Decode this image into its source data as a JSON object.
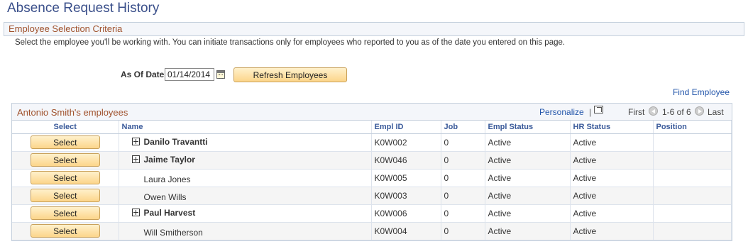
{
  "page": {
    "title": "Absence Request History"
  },
  "criteria": {
    "header": "Employee Selection Criteria",
    "instructions": "Select the employee you'll be working with. You can initiate transactions only for employees who reported to you as of the date you entered on this page.",
    "as_of_label": "As Of Date",
    "as_of_value": "01/14/2014",
    "calendar_icon": "calendar-icon",
    "refresh_label": "Refresh Employees",
    "find_employee": "Find Employee"
  },
  "grid": {
    "title": "Antonio Smith's employees",
    "personalize": "Personalize",
    "separator": "|",
    "first": "First",
    "range": "1-6 of 6",
    "last": "Last",
    "columns": [
      "Select",
      "Name",
      "Empl ID",
      "Job",
      "Empl Status",
      "HR Status",
      "Position"
    ],
    "select_label": "Select",
    "rows": [
      {
        "name": "Danilo Travantti",
        "expandable": true,
        "empl_id": "K0W002",
        "job": "0",
        "empl_status": "Active",
        "hr_status": "Active",
        "position": ""
      },
      {
        "name": "Jaime Taylor",
        "expandable": true,
        "empl_id": "K0W046",
        "job": "0",
        "empl_status": "Active",
        "hr_status": "Active",
        "position": ""
      },
      {
        "name": "Laura Jones",
        "expandable": false,
        "empl_id": "K0W005",
        "job": "0",
        "empl_status": "Active",
        "hr_status": "Active",
        "position": ""
      },
      {
        "name": "Owen Wills",
        "expandable": false,
        "empl_id": "K0W003",
        "job": "0",
        "empl_status": "Active",
        "hr_status": "Active",
        "position": ""
      },
      {
        "name": "Paul Harvest",
        "expandable": true,
        "empl_id": "K0W006",
        "job": "0",
        "empl_status": "Active",
        "hr_status": "Active",
        "position": ""
      },
      {
        "name": "Will Smitherson",
        "expandable": false,
        "empl_id": "K0W004",
        "job": "0",
        "empl_status": "Active",
        "hr_status": "Active",
        "position": ""
      }
    ]
  },
  "colors": {
    "title": "#3a4f8a",
    "section_header_text": "#a0522d",
    "link": "#2255aa",
    "button_top": "#fff1cc",
    "button_bottom": "#fcd58a"
  }
}
